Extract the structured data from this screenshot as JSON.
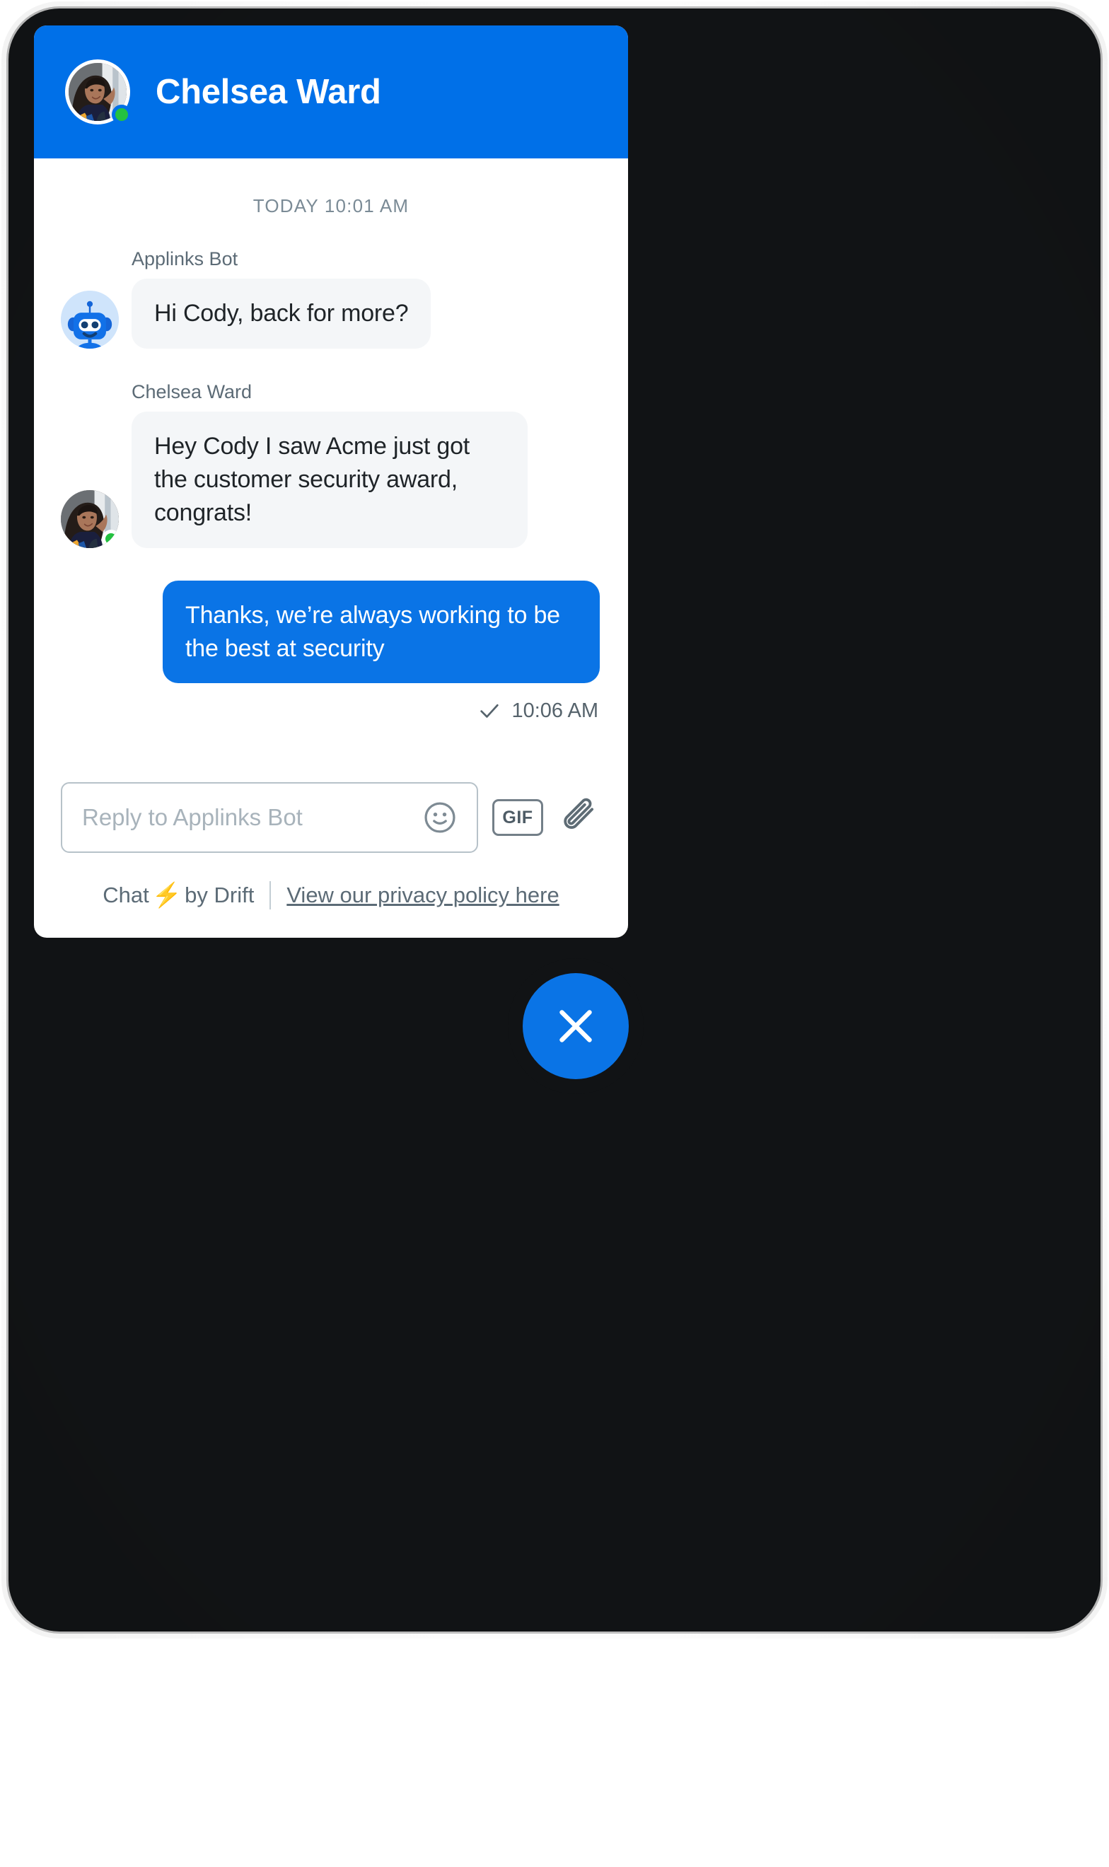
{
  "header": {
    "title": "Chelsea Ward",
    "avatar_icon": "user-photo-avatar",
    "status": "online",
    "status_color": "#24C140",
    "background_color": "#0070E8"
  },
  "conversation": {
    "day_divider": "TODAY 10:01 AM",
    "messages": [
      {
        "sender": "Applinks Bot",
        "avatar_icon": "robot-avatar",
        "text": "Hi Cody, back for more?",
        "direction": "in"
      },
      {
        "sender": "Chelsea Ward",
        "avatar_icon": "user-photo-avatar",
        "text": "Hey Cody I saw Acme just got the customer security award, congrats!",
        "direction": "in"
      },
      {
        "sender": "",
        "avatar_icon": "",
        "text": "Thanks, we’re always working to be the best at security",
        "direction": "out",
        "receipt_time": "10:06 AM",
        "receipt_icon": "check-icon"
      }
    ]
  },
  "composer": {
    "placeholder": "Reply to Applinks Bot",
    "value": "",
    "emoji_icon": "smiley-face-icon",
    "gif_label": "GIF",
    "attachment_icon": "paperclip-icon"
  },
  "footer": {
    "brand_prefix": "Chat",
    "brand_bolt": "⚡",
    "brand_suffix": "by Drift",
    "privacy_link": "View our privacy policy here"
  },
  "fab": {
    "icon": "close-icon",
    "color": "#0A74E6"
  },
  "colors": {
    "accent": "#0070E8",
    "outgoing_bubble": "#0A74E6",
    "incoming_bubble": "#F4F6F8",
    "online": "#24C140",
    "frame": "#111315"
  }
}
